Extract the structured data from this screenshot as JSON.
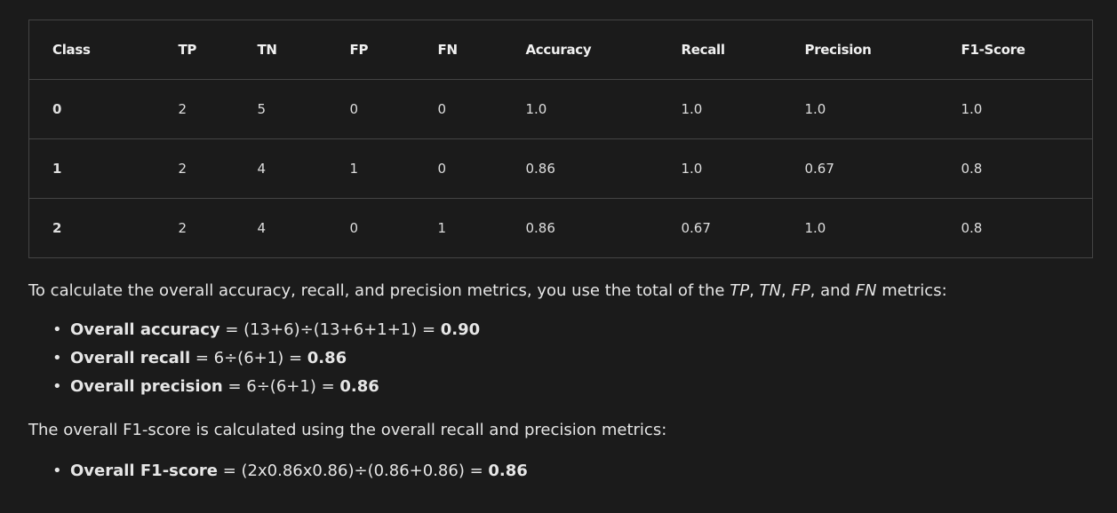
{
  "table": {
    "headers": [
      "Class",
      "TP",
      "TN",
      "FP",
      "FN",
      "Accuracy",
      "Recall",
      "Precision",
      "F1-Score"
    ],
    "rows": [
      [
        "0",
        "2",
        "5",
        "0",
        "0",
        "1.0",
        "1.0",
        "1.0",
        "1.0"
      ],
      [
        "1",
        "2",
        "4",
        "1",
        "0",
        "0.86",
        "1.0",
        "0.67",
        "0.8"
      ],
      [
        "2",
        "2",
        "4",
        "0",
        "1",
        "0.86",
        "0.67",
        "1.0",
        "0.8"
      ]
    ]
  },
  "paragraph1": {
    "prefix": "To calculate the overall accuracy, recall, and precision metrics, you use the total of the ",
    "tp": "TP",
    "sep1": ", ",
    "tn": "TN",
    "sep2": ", ",
    "fp": "FP",
    "sep3": ", and ",
    "fn": "FN",
    "suffix": " metrics:"
  },
  "list1": [
    {
      "term": "Overall accuracy",
      "formula": " = (13+6)÷(13+6+1+1) = ",
      "result": "0.90"
    },
    {
      "term": "Overall recall",
      "formula": " = 6÷(6+1) = ",
      "result": "0.86"
    },
    {
      "term": "Overall precision",
      "formula": " = 6÷(6+1) = ",
      "result": "0.86"
    }
  ],
  "paragraph2": "The overall F1-score is calculated using the overall recall and precision metrics:",
  "list2": [
    {
      "term": "Overall F1-score",
      "formula": " = (2x0.86x0.86)÷(0.86+0.86) = ",
      "result": "0.86"
    }
  ]
}
